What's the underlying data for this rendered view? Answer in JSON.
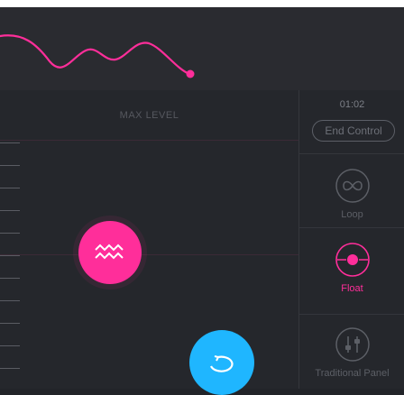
{
  "header": {
    "max_level_label": "MAX LEVEL"
  },
  "sidebar": {
    "timer": "01:02",
    "end_control_label": "End Control",
    "modes": [
      {
        "label": "Loop",
        "icon": "infinity-icon",
        "active": false
      },
      {
        "label": "Float",
        "icon": "float-icon",
        "active": true
      },
      {
        "label": "Traditional Panel",
        "icon": "sliders-icon",
        "active": false
      }
    ]
  },
  "controls": {
    "float_button_icon": "waves-icon",
    "loop_button_icon": "loop-icon"
  },
  "colors": {
    "accent": "#ff2e9a",
    "loop": "#1fb6ff",
    "background": "#222429"
  }
}
